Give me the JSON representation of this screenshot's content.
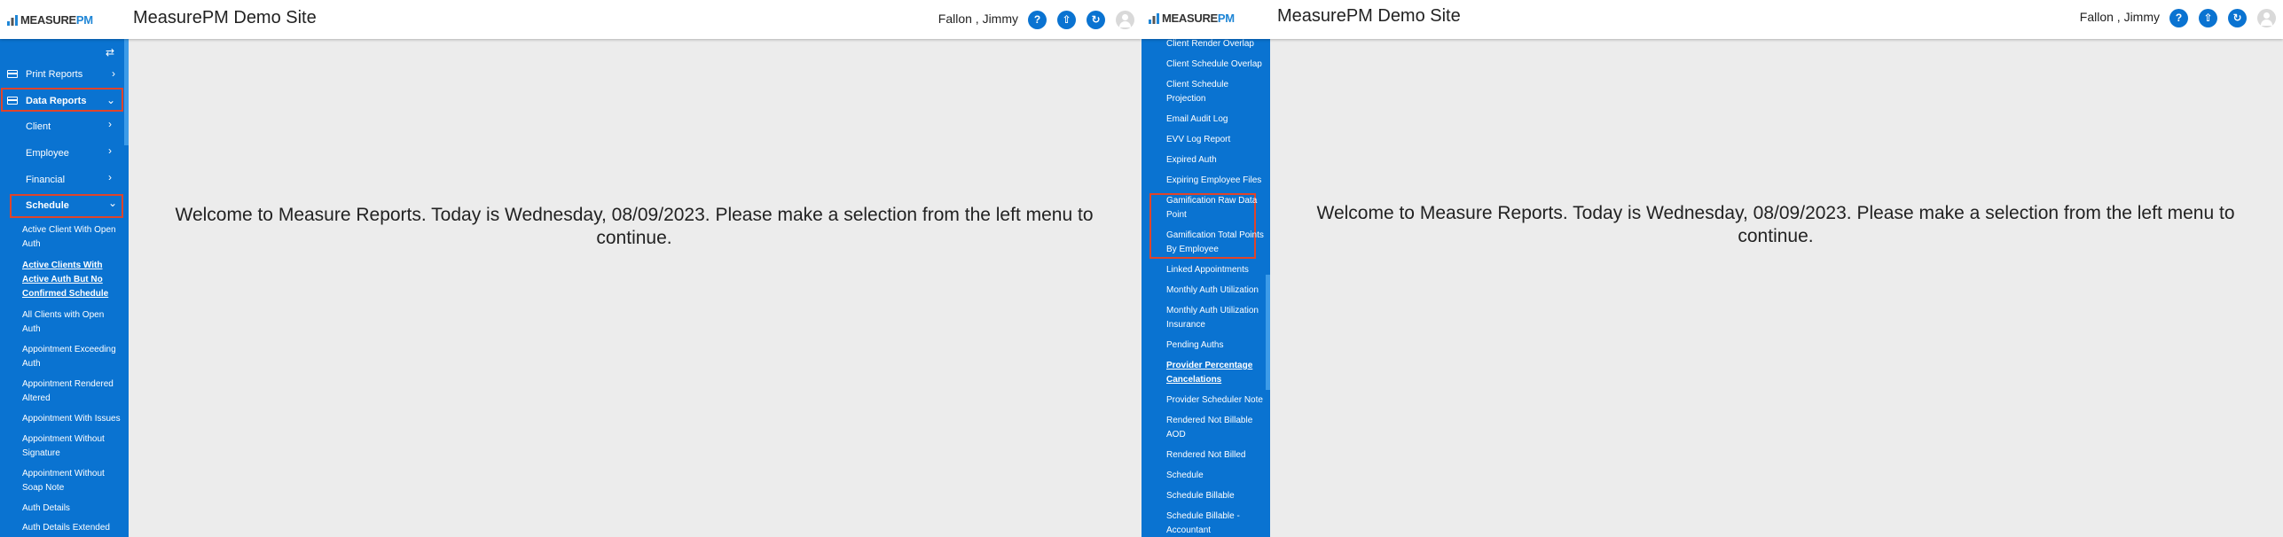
{
  "colors": {
    "sidebar": "#0a73d1",
    "highlight": "#e0442a",
    "background": "#ececec"
  },
  "header": {
    "logo_text": "MEASURE",
    "logo_accent": "PM",
    "site_title": "MeasurePM Demo Site",
    "user_name": "Fallon , Jimmy",
    "help_glyph": "?",
    "up_glyph": "⇧",
    "refresh_glyph": "↻"
  },
  "welcome_message": "Welcome to Measure Reports. Today is Wednesday, 08/09/2023. Please make a selection from the left menu to continue.",
  "left_sidebar": {
    "toggle_glyph": "⇄",
    "print_reports": "Print Reports",
    "data_reports": "Data Reports",
    "client": "Client",
    "employee": "Employee",
    "financial": "Financial",
    "schedule": "Schedule",
    "links": [
      "Active Client With Open Auth",
      "Active Clients With Active Auth But No Confirmed Schedule",
      "All Clients with Open Auth",
      "Appointment Exceeding Auth",
      "Appointment Rendered Altered",
      "Appointment With Issues",
      "Appointment Without Signature",
      "Appointment Without Soap Note",
      "Auth Details",
      "Auth Details Extended"
    ]
  },
  "right_sidebar": {
    "links": [
      "Client Render Overlap",
      "Client Schedule Overlap",
      "Client Schedule Projection",
      "Email Audit Log",
      "EVV Log Report",
      "Expired Auth",
      "Expiring Employee Files",
      "Gamification Raw Data Point",
      "Gamification Total Points By Employee",
      "Linked Appointments",
      "Monthly Auth Utilization",
      "Monthly Auth Utilization Insurance",
      "Pending Auths",
      "Provider Percentage Cancelations",
      "Provider Scheduler Note",
      "Rendered Not Billable AOD",
      "Rendered Not Billed",
      "Schedule",
      "Schedule Billable",
      "Schedule Billable - Accountant"
    ]
  }
}
